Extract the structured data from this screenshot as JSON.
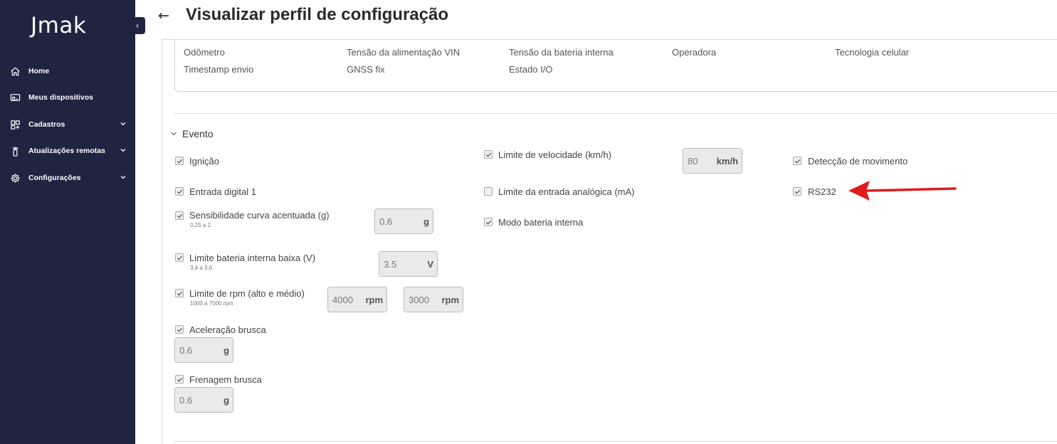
{
  "sidebar": {
    "logo": "Jmak",
    "collapse_icon": "chevron-left-icon",
    "items": [
      {
        "label": "Home",
        "icon": "home-icon",
        "has_chevron": false
      },
      {
        "label": "Meus dispositivos",
        "icon": "devices-icon",
        "has_chevron": false
      },
      {
        "label": "Cadastros",
        "icon": "grid-add-icon",
        "has_chevron": true
      },
      {
        "label": "Atualizações remotas",
        "icon": "remote-update-icon",
        "has_chevron": true
      },
      {
        "label": "Configurações",
        "icon": "gear-icon",
        "has_chevron": true
      }
    ]
  },
  "header": {
    "back_icon": "arrow-left-icon",
    "title": "Visualizar perfil de configuração"
  },
  "sensors": {
    "row1": [
      "Odômetro",
      "Tensão da alimentação VIN",
      "Tensão da bateria interna",
      "Operadora",
      "Tecnologia celular"
    ],
    "row2": [
      "Timestamp envio",
      "GNSS fix",
      "Estado I/O"
    ]
  },
  "evento": {
    "title": "Evento",
    "ignicao": {
      "label": "Ignição",
      "checked": true
    },
    "entrada_digital": {
      "label": "Entrada digital 1",
      "checked": true
    },
    "sensibilidade": {
      "label": "Sensibilidade curva acentuada (g)",
      "hint": "0,25 a 2",
      "value": "0.6",
      "unit": "g",
      "checked": true
    },
    "limite_bateria": {
      "label": "Limite bateria interna baixa (V)",
      "hint": "3,4 a 3,6",
      "value": "3.5",
      "unit": "V",
      "checked": true
    },
    "limite_rpm": {
      "label": "Limite de rpm (alto e médio)",
      "hint": "1000 a 7000 rpm",
      "value_high": "4000",
      "value_medium": "3000",
      "unit": "rpm",
      "checked": true
    },
    "aceleracao": {
      "label": "Aceleração brusca",
      "value": "0.6",
      "unit": "g",
      "checked": true
    },
    "frenagem": {
      "label": "Frenagem brusca",
      "value": "0.6",
      "unit": "g",
      "checked": true
    },
    "limite_velocidade": {
      "label": "Limite de velocidade (km/h)",
      "value": "80",
      "unit": "km/h",
      "checked": true
    },
    "limite_analogica": {
      "label": "Limite da entrada analógica (mA)",
      "checked": false
    },
    "modo_bateria": {
      "label": "Modo bateria interna",
      "checked": true
    },
    "deteccao_movimento": {
      "label": "Detecção de movimento",
      "checked": true
    },
    "rs232": {
      "label": "RS232",
      "checked": true
    }
  },
  "annotation": {
    "arrow_color": "#e01b1b"
  },
  "colors": {
    "sidebar_bg": "#1f2440",
    "checkbox_border": "#aaaaaa"
  }
}
